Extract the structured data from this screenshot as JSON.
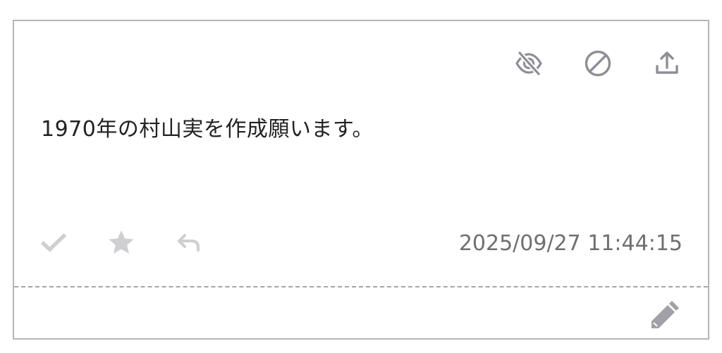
{
  "message": {
    "text": "1970年の村山実を作成願います。",
    "timestamp": "2025/09/27 11:44:15"
  },
  "top_actions": [
    {
      "icon": "eye-off-icon",
      "label": "hide"
    },
    {
      "icon": "block-icon",
      "label": "block"
    },
    {
      "icon": "upload-icon",
      "label": "share"
    }
  ],
  "bottom_actions": [
    {
      "icon": "check-icon",
      "label": "check"
    },
    {
      "icon": "star-icon",
      "label": "favorite"
    },
    {
      "icon": "reply-icon",
      "label": "reply"
    }
  ],
  "footer": {
    "edit_icon": "pencil-icon"
  },
  "colors": {
    "border": "#b4b4bc",
    "icon_dark": "#8e8e96",
    "icon_light": "#cfcfd3",
    "text": "#222222",
    "timestamp": "#6f6f6f",
    "pencil": "#a0a0a6"
  }
}
